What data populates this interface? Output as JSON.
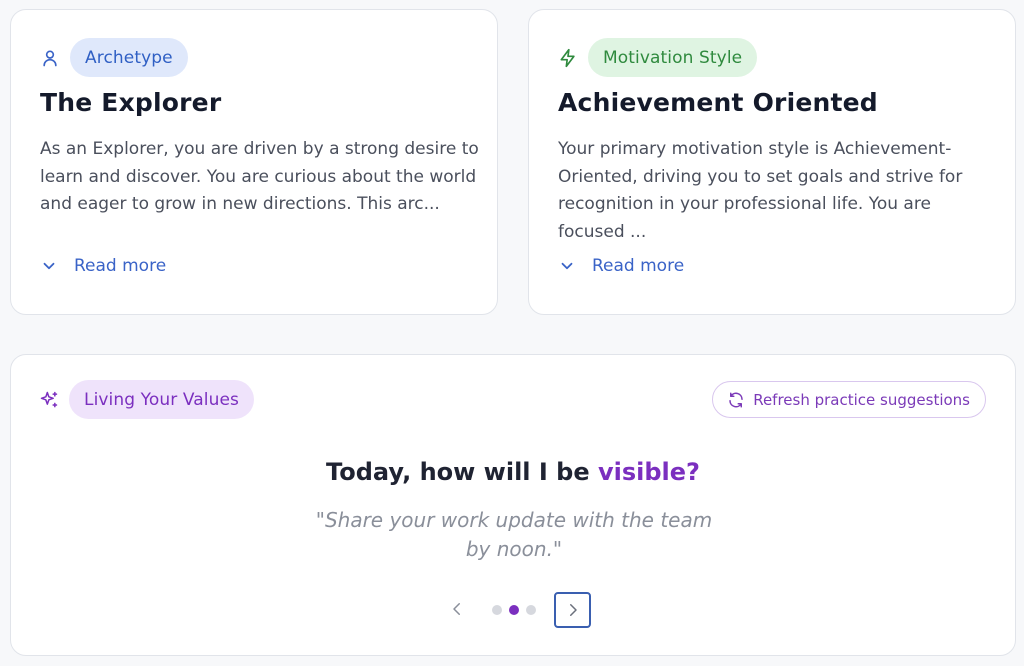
{
  "archetype": {
    "tag": "Archetype",
    "icon": "user-icon",
    "title": "The Explorer",
    "description": "As an Explorer, you are driven by a strong desire to learn and discover. You are curious about the world and eager to grow in new directions. This arc...",
    "read_more": "Read more"
  },
  "motivation": {
    "tag": "Motivation Style",
    "icon": "lightning-icon",
    "title": "Achievement Oriented",
    "description": "Your primary motivation style is Achievement-Oriented, driving you to set goals and strive for recognition in your professional life. You are focused ...",
    "read_more": "Read more"
  },
  "values": {
    "tag": "Living Your Values",
    "icon": "sparkles-icon",
    "refresh_label": "Refresh practice suggestions",
    "prompt_prefix": "Today, how will I be ",
    "prompt_accent": "visible?",
    "quote": "\"Share your work update with the team by noon.\"",
    "carousel": {
      "total": 3,
      "active_index": 1
    }
  },
  "colors": {
    "accent_purple": "#7b2fbf",
    "accent_blue": "#2f5fc4",
    "accent_green": "#2f8a3e"
  }
}
